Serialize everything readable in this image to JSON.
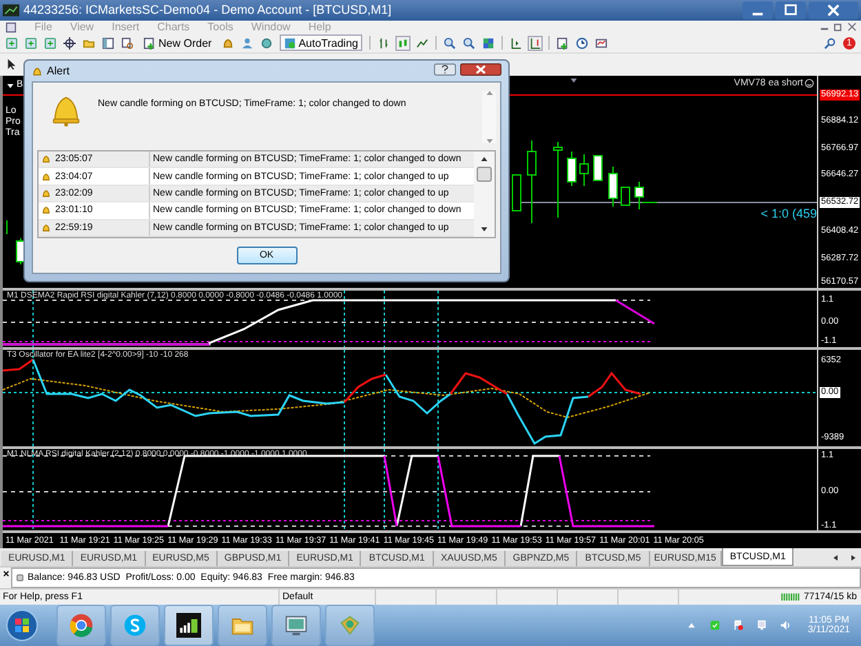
{
  "window": {
    "title": "44233256: ICMarketsSC-Demo04 - Demo Account - [BTCUSD,M1]"
  },
  "menu": [
    {
      "label": "File",
      "disabled": true
    },
    {
      "label": "View",
      "disabled": true
    },
    {
      "label": "Insert",
      "disabled": true
    },
    {
      "label": "Charts",
      "disabled": true
    },
    {
      "label": "Tools",
      "disabled": true
    },
    {
      "label": "Window",
      "disabled": true
    },
    {
      "label": "Help",
      "disabled": true
    }
  ],
  "toolbar": {
    "new_order": "New Order",
    "autotrading": "AutoTrading",
    "notifications": "1"
  },
  "chart": {
    "tab_label": "B",
    "side_labels": [
      "Lo",
      "Pro",
      "Tra"
    ],
    "expert": "VMV78 ea short",
    "trade_note": "< 1:0 (459",
    "price_axis": [
      {
        "label": "56992.13",
        "kind": "alert"
      },
      {
        "label": "56884.12",
        "kind": "tick"
      },
      {
        "label": "56766.97",
        "kind": "tick"
      },
      {
        "label": "56646.27",
        "kind": "tick"
      },
      {
        "label": "56532.72",
        "kind": "bid"
      },
      {
        "label": "56408.42",
        "kind": "tick"
      },
      {
        "label": "56287.72",
        "kind": "tick"
      },
      {
        "label": "56170.57",
        "kind": "tick"
      }
    ]
  },
  "indicators": [
    {
      "title": "M1 DSEMA2 Rapid RSI digital Kahler (7,12) 0.8000 0.0000 -0.8000 -0.0486 -0.0486 1.0000",
      "axis": [
        {
          "label": "1.1",
          "kind": "tick"
        },
        {
          "label": "0.00",
          "kind": "tick"
        },
        {
          "label": "-1.1",
          "kind": "tick"
        }
      ]
    },
    {
      "title": "T3 Oscillator for EA lite2 [4-2^0.00>9]  -10 -10 268",
      "axis": [
        {
          "label": "6352",
          "kind": "tick"
        },
        {
          "label": "0.00",
          "kind": "current"
        },
        {
          "label": "-9389",
          "kind": "tick"
        }
      ]
    },
    {
      "title": "M1 NLMA RSI digital Kahler (2,12) 0.8000 0.0000 -0.8000 -1.0000 -1.0000 1.0000",
      "axis": [
        {
          "label": "1.1",
          "kind": "tick"
        },
        {
          "label": "0.00",
          "kind": "tick"
        },
        {
          "label": "-1.1",
          "kind": "tick"
        }
      ]
    }
  ],
  "time_axis": [
    "11 Mar 2021",
    "11 Mar 19:21",
    "11 Mar 19:25",
    "11 Mar 19:29",
    "11 Mar 19:33",
    "11 Mar 19:37",
    "11 Mar 19:41",
    "11 Mar 19:45",
    "11 Mar 19:49",
    "11 Mar 19:53",
    "11 Mar 19:57",
    "11 Mar 20:01",
    "11 Mar 20:05"
  ],
  "tabs": [
    {
      "label": "EURUSD,M1",
      "selected": false
    },
    {
      "label": "EURUSD,M1",
      "selected": false
    },
    {
      "label": "EURUSD,M5",
      "selected": false
    },
    {
      "label": "GBPUSD,M1",
      "selected": false
    },
    {
      "label": "EURUSD,M1",
      "selected": false
    },
    {
      "label": "BTCUSD,M1",
      "selected": false
    },
    {
      "label": "XAUUSD,M5",
      "selected": false
    },
    {
      "label": "GBPNZD,M5",
      "selected": false
    },
    {
      "label": "BTCUSD,M5",
      "selected": false
    },
    {
      "label": "EURUSD,M15",
      "selected": false
    },
    {
      "label": "BTCUSD,M1",
      "selected": true
    }
  ],
  "terminal": {
    "summary": "Balance: 946.83 USD  Profit/Loss: 0.00  Equity: 946.83  Free margin: 946.83"
  },
  "status_bar": {
    "help": "For Help, press F1",
    "profile": "Default",
    "traffic": "77174/15 kb"
  },
  "alert": {
    "title": "Alert",
    "message": "New candle forming on BTCUSD; TimeFrame: 1; color changed to down",
    "rows": [
      {
        "time": "23:05:07",
        "text": "New candle forming on BTCUSD; TimeFrame: 1; color changed to down"
      },
      {
        "time": "23:04:07",
        "text": "New candle forming on BTCUSD; TimeFrame: 1; color changed to up"
      },
      {
        "time": "23:02:09",
        "text": "New candle forming on BTCUSD; TimeFrame: 1; color changed to up"
      },
      {
        "time": "23:01:10",
        "text": "New candle forming on BTCUSD; TimeFrame: 1; color changed to down"
      },
      {
        "time": "22:59:19",
        "text": "New candle forming on BTCUSD; TimeFrame: 1; color changed to up"
      }
    ],
    "button": "OK"
  },
  "taskbar": {
    "time": "11:05 PM",
    "date": "3/11/2021"
  }
}
